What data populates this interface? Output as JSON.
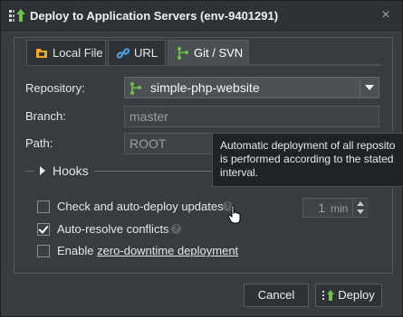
{
  "dialog": {
    "title": "Deploy to Application Servers (env-9401291)",
    "close_label": "×"
  },
  "tabs": [
    {
      "label": "Local File",
      "icon": "folder-icon",
      "active": false
    },
    {
      "label": "URL",
      "icon": "link-icon",
      "active": false
    },
    {
      "label": "Git / SVN",
      "icon": "git-branch-icon",
      "active": true
    }
  ],
  "form": {
    "repository_label": "Repository:",
    "repository_value": "simple-php-website",
    "branch_label": "Branch:",
    "branch_value": "master",
    "path_label": "Path:",
    "path_value": "ROOT"
  },
  "hooks": {
    "label": "Hooks"
  },
  "options": {
    "auto_deploy_label": "Check and auto-deploy updates",
    "auto_deploy_checked": false,
    "interval_value": "1",
    "interval_unit": "min",
    "auto_resolve_label": "Auto-resolve conflicts",
    "auto_resolve_checked": true,
    "zero_downtime_prefix": "Enable ",
    "zero_downtime_link": "zero-downtime deployment",
    "zero_downtime_checked": false
  },
  "tooltip": {
    "line1": "Automatic deployment of all reposito",
    "line2": "is performed according to the stated",
    "line3": "interval."
  },
  "buttons": {
    "cancel": "Cancel",
    "deploy": "Deploy"
  },
  "colors": {
    "accent_green": "#6cc24a",
    "accent_orange": "#f5a623",
    "link_blue": "#4aa3df"
  }
}
